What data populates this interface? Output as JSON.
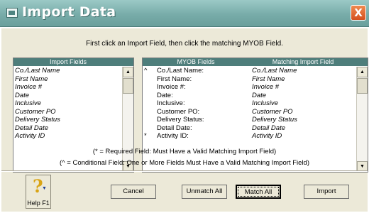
{
  "window": {
    "title": "Import Data",
    "close_glyph": "X"
  },
  "instruction": "First click an Import Field, then click the matching MYOB Field.",
  "import_fields": {
    "header": "Import Fields",
    "items": [
      "Co./Last Name",
      "First Name",
      "Invoice #",
      "Date",
      "Inclusive",
      "Customer PO",
      "Delivery Status",
      "Detail Date",
      "Activity ID"
    ]
  },
  "myob_fields": {
    "header_field": "MYOB Fields",
    "header_match": "Matching Import Field",
    "rows": [
      {
        "mark": "^",
        "field": "Co./Last Name:",
        "match": "Co./Last Name"
      },
      {
        "mark": "",
        "field": "First Name:",
        "match": "First Name"
      },
      {
        "mark": "",
        "field": "Invoice #:",
        "match": "Invoice #"
      },
      {
        "mark": "",
        "field": "Date:",
        "match": "Date"
      },
      {
        "mark": "",
        "field": "Inclusive:",
        "match": "Inclusive"
      },
      {
        "mark": "",
        "field": "Customer PO:",
        "match": "Customer PO"
      },
      {
        "mark": "",
        "field": "Delivery Status:",
        "match": "Delivery Status"
      },
      {
        "mark": "",
        "field": "Detail Date:",
        "match": "Detail Date"
      },
      {
        "mark": "*",
        "field": "Activity ID:",
        "match": "Activity ID"
      }
    ]
  },
  "notes": {
    "required": "(* = Required Field:  Must Have a Valid Matching Import Field)",
    "conditional": "(^ = Conditional Field:  One or More Fields Must Have a Valid Matching Import Field)"
  },
  "help": {
    "label": "Help F1",
    "glyph": "?"
  },
  "buttons": {
    "cancel": "Cancel",
    "unmatch_all": "Unmatch All",
    "match_all": "Match All",
    "import": "Import"
  },
  "colors": {
    "title_bar": "#78aca9",
    "panel_header": "#4e7e7b",
    "dialog_bg": "#ece9d8",
    "close_button": "#d4501e"
  },
  "icons": [
    "window-icon",
    "close-icon",
    "scroll-up-icon",
    "scroll-down-icon",
    "help-question-icon"
  ]
}
